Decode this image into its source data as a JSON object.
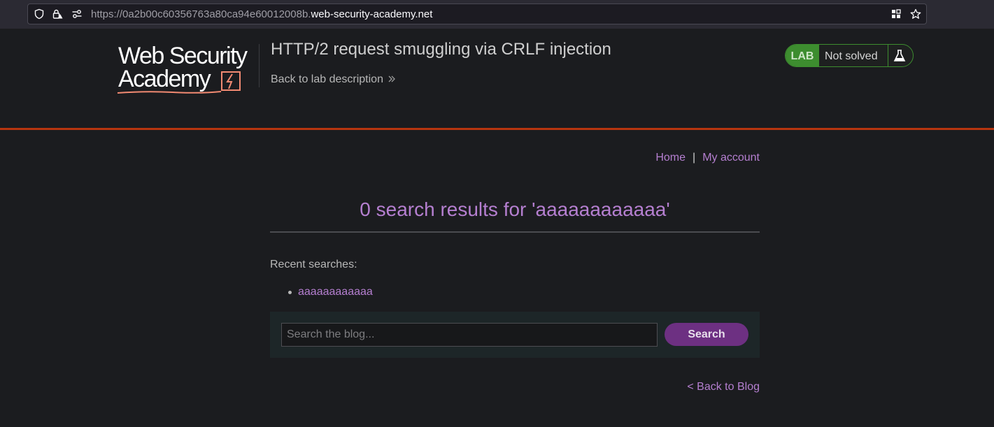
{
  "browser": {
    "url_prefix": "https://0a2b00c60356763a80ca94e60012008b.",
    "url_host": "web-security-academy.net",
    "icons": [
      "shield-icon",
      "lock-warning-icon",
      "permissions-icon",
      "extensions-icon",
      "bookmark-star-icon"
    ]
  },
  "lab": {
    "logo_line1": "Web Security",
    "logo_line2": "Academy",
    "title": "HTTP/2 request smuggling via CRLF injection",
    "back_description": "Back to lab description",
    "badge": "LAB",
    "status": "Not solved",
    "status_color": "#3d8d2f",
    "accent_color": "#b8350f"
  },
  "nav": {
    "home": "Home",
    "separator": "|",
    "account": "My account"
  },
  "results": {
    "title": "0 search results for 'aaaaaaaaaaaa'"
  },
  "recent": {
    "label": "Recent searches:",
    "items": [
      "aaaaaaaaaaaa"
    ]
  },
  "search": {
    "placeholder": "Search the blog...",
    "value": "",
    "button": "Search"
  },
  "footer": {
    "back_to_blog": "< Back to Blog"
  },
  "colors": {
    "link": "#b57fd0",
    "button": "#6d3082",
    "background": "#1b1c1f"
  }
}
